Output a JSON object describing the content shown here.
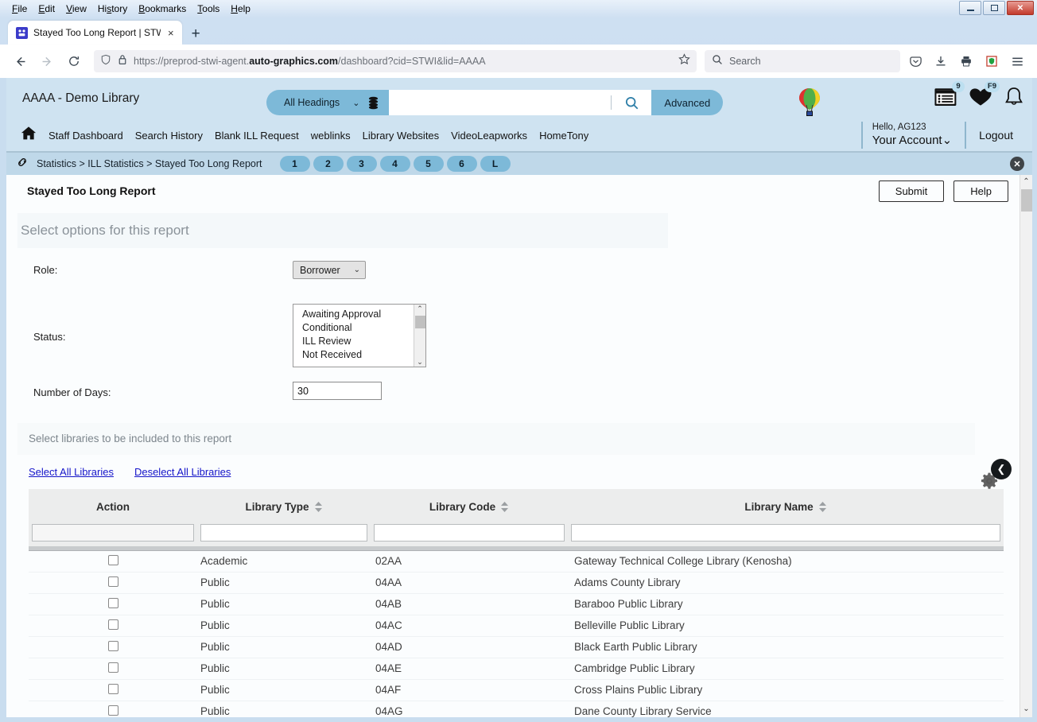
{
  "browser": {
    "menus": [
      "File",
      "Edit",
      "View",
      "History",
      "Bookmarks",
      "Tools",
      "Help"
    ],
    "tab_title": "Stayed Too Long Report | STWI",
    "tab_close": "×",
    "new_tab": "+",
    "url_prefix": "https://preprod-stwi-agent.",
    "url_domain": "auto-graphics.com",
    "url_suffix": "/dashboard?cid=STWI&lid=AAAA",
    "search_placeholder": "Search",
    "back_icon": "←",
    "forward_icon": "→",
    "reload_icon": "↻",
    "window_buttons": {
      "minimize": "–",
      "maximize": "❐",
      "close": "✕"
    }
  },
  "header": {
    "library_title": "AAAA - Demo Library",
    "heading_filter": "All Headings",
    "chevron": "⌄",
    "search_value": "",
    "advanced_label": "Advanced",
    "list_badge": "9",
    "heart_badge": "F9"
  },
  "nav": {
    "home_icon": "home-icon",
    "links": [
      "Staff Dashboard",
      "Search History",
      "Blank ILL Request",
      "weblinks",
      "Library Websites",
      "VideoLeapworks",
      "HomeTony"
    ],
    "hello": "Hello, AG123",
    "account": "Your Account",
    "account_chevron": "⌄",
    "logout": "Logout"
  },
  "breadcrumb": {
    "path": "Statistics > ILL Statistics > Stayed Too Long Report",
    "steps": [
      "1",
      "2",
      "3",
      "4",
      "5",
      "6",
      "L"
    ],
    "close_icon": "✖"
  },
  "content": {
    "title": "Stayed Too Long Report",
    "submit_label": "Submit",
    "help_label": "Help",
    "options_title": "Select options for this report",
    "role_label": "Role:",
    "role_value": "Borrower",
    "status_label": "Status:",
    "status_options": [
      "Awaiting Approval",
      "Conditional",
      "ILL Review",
      "Not Received"
    ],
    "days_label": "Number of Days:",
    "days_value": "30",
    "libraries_title": "Select libraries to be included to this report",
    "select_all": "Select All Libraries",
    "deselect_all": "Deselect All Libraries",
    "collapse_icon": "❮"
  },
  "table": {
    "columns": [
      "Action",
      "Library Type",
      "Library Code",
      "Library Name"
    ],
    "filters": [
      "",
      "",
      "",
      ""
    ],
    "rows": [
      {
        "type": "Academic",
        "code": "02AA",
        "name": "Gateway Technical College Library (Kenosha)"
      },
      {
        "type": "Public",
        "code": "04AA",
        "name": "Adams County Library"
      },
      {
        "type": "Public",
        "code": "04AB",
        "name": "Baraboo Public Library"
      },
      {
        "type": "Public",
        "code": "04AC",
        "name": "Belleville Public Library"
      },
      {
        "type": "Public",
        "code": "04AD",
        "name": "Black Earth Public Library"
      },
      {
        "type": "Public",
        "code": "04AE",
        "name": "Cambridge Public Library"
      },
      {
        "type": "Public",
        "code": "04AF",
        "name": "Cross Plains Public Library"
      },
      {
        "type": "Public",
        "code": "04AG",
        "name": "Dane County Library Service"
      }
    ]
  },
  "colors": {
    "app_header": "#cfe3f1",
    "accent": "#7db9d8",
    "link": "#1515c9",
    "table_header": "#eceded"
  }
}
